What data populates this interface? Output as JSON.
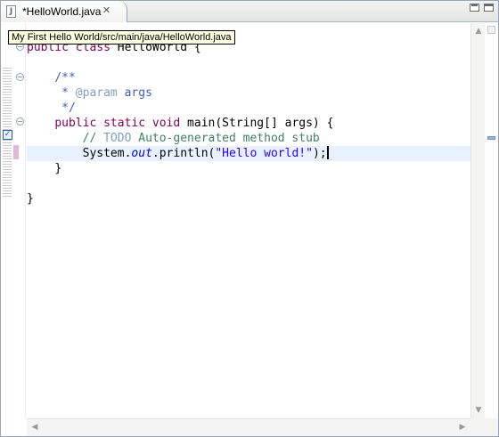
{
  "tab": {
    "title": "*HelloWorld.java",
    "file_icon": "java-file-icon",
    "close_icon": "close-icon"
  },
  "window_controls": {
    "minimize": "minimize-icon",
    "maximize": "maximize-icon"
  },
  "tooltip": {
    "text": "My First Hello World/src/main/java/HelloWorld.java"
  },
  "editor": {
    "lines": {
      "l1": {
        "kw1": "public",
        "kw2": "class",
        "name": " HelloWorld {"
      },
      "l3": {
        "text": "/**"
      },
      "l4": {
        "star": " * ",
        "tag": "@param",
        "rest": " args"
      },
      "l5": {
        "text": " */"
      },
      "l6": {
        "kw1": "public",
        "kw2": "static",
        "kw3": "void",
        "rest": " main(String[] args) {"
      },
      "l7": {
        "slashes": "// ",
        "todo": "TODO",
        "rest": " Auto-generated method stub"
      },
      "l8": {
        "obj": "System.",
        "field": "out",
        "call": ".println(",
        "str": "\"Hello world!\"",
        "end": ");"
      },
      "l9": {
        "text": "}"
      },
      "l11": {
        "text": "}"
      }
    },
    "current_line": 8
  },
  "colors": {
    "keyword": "#7f0055",
    "javadoc": "#3f5fbf",
    "comment": "#3f7f5f",
    "string": "#2a00ff",
    "current_line_bg": "#e8f2fe",
    "tooltip_bg": "#ffffe1"
  }
}
